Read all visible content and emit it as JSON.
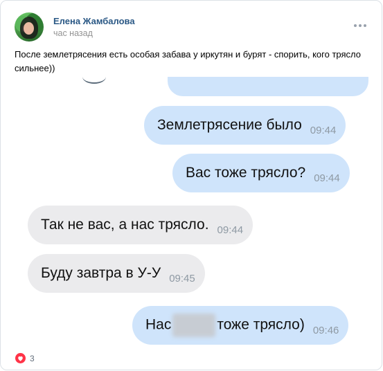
{
  "post": {
    "author": "Елена Жамбалова",
    "time": "час назад",
    "text": "После землетрясения есть особая забава у иркутян и бурят - спорить, кого трясло сильнее))",
    "likes": "3",
    "icons": {
      "like": "heart-icon",
      "menu": "more-dots-icon"
    },
    "colors": {
      "author": "#2a5885",
      "like": "#ff3347",
      "outgoing_bubble": "#cfe4fb",
      "incoming_bubble": "#ebebed"
    }
  },
  "chat": {
    "messages": [
      {
        "direction": "outgoing",
        "text": "Землетрясение было",
        "time": "09:44"
      },
      {
        "direction": "outgoing",
        "text": "Вас тоже трясло?",
        "time": "09:44"
      },
      {
        "direction": "incoming",
        "text": "Так не вас, а нас трясло.",
        "time": "09:44"
      },
      {
        "direction": "incoming",
        "text": "Буду завтра в У-У",
        "time": "09:45"
      },
      {
        "direction": "outgoing",
        "text_before": "Нас",
        "text_after": "тоже трясло)",
        "time": "09:46"
      }
    ]
  }
}
